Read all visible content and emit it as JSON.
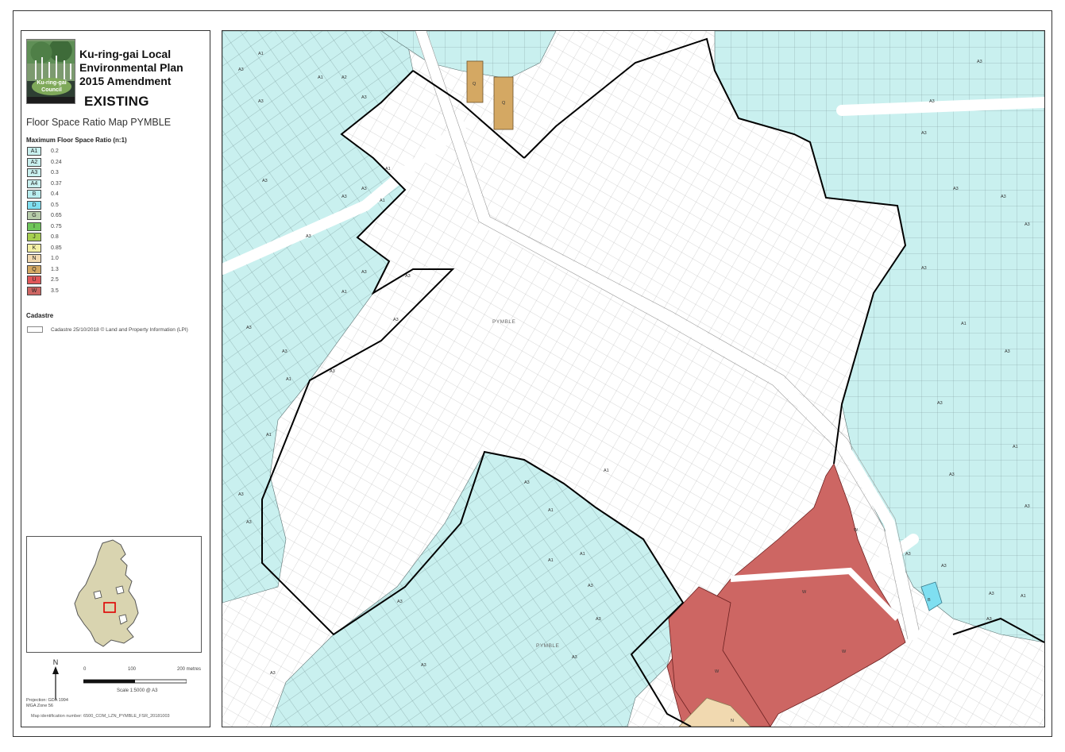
{
  "header": {
    "title_lines": [
      "Ku-ring-gai Local",
      "Environmental Plan",
      "2015 Amendment"
    ],
    "status": "EXISTING",
    "map_name": "Floor Space Ratio Map PYMBLE",
    "logo_text": "Ku-ring-gai Council"
  },
  "legend": {
    "heading": "Maximum Floor Space Ratio (n:1)",
    "items": [
      {
        "code": "A1",
        "value": "0.2",
        "color": "#c9f0ef"
      },
      {
        "code": "A2",
        "value": "0.24",
        "color": "#c9f0ef"
      },
      {
        "code": "A3",
        "value": "0.3",
        "color": "#c9f0ef"
      },
      {
        "code": "A4",
        "value": "0.37",
        "color": "#c9f0ef"
      },
      {
        "code": "B",
        "value": "0.4",
        "color": "#b9eef0"
      },
      {
        "code": "D",
        "value": "0.5",
        "color": "#7fdff1"
      },
      {
        "code": "G",
        "value": "0.65",
        "color": "#b7ccaa"
      },
      {
        "code": "I",
        "value": "0.75",
        "color": "#6fc65b"
      },
      {
        "code": "J",
        "value": "0.8",
        "color": "#a6cf4f"
      },
      {
        "code": "K",
        "value": "0.85",
        "color": "#f3f0a4"
      },
      {
        "code": "N",
        "value": "1.0",
        "color": "#f1d9b0"
      },
      {
        "code": "Q",
        "value": "1.3",
        "color": "#d4a863"
      },
      {
        "code": "U",
        "value": "2.5",
        "color": "#e0575a"
      },
      {
        "code": "W",
        "value": "3.5",
        "color": "#cd6663"
      }
    ]
  },
  "cadastre": {
    "heading": "Cadastre",
    "label": "Cadastre 25/10/2018 © Land and Property Information (LPI)"
  },
  "scale": {
    "north": "N",
    "ticks": [
      "0",
      "100",
      "200 metres"
    ],
    "text": "Scale  1:5000   @ A3",
    "projection": [
      "Projection: GDA 1994",
      "MGA Zone 56"
    ]
  },
  "map_id": "Map identification number:   6500_COM_LZN_PYMBLE_FSR_20181003",
  "map": {
    "place_labels": [
      "PYMBLE",
      "PYMBLE"
    ],
    "zone_labels": [
      "A1",
      "A3",
      "A3",
      "A1",
      "A2",
      "A3",
      "A1",
      "A3",
      "A3",
      "A1",
      "A3",
      "A3",
      "A3",
      "A3",
      "A1",
      "A3",
      "A3",
      "A3",
      "A1",
      "A3",
      "A1",
      "A3",
      "A3",
      "A3",
      "A1",
      "A1",
      "A3",
      "Q",
      "Q",
      "W",
      "W",
      "W",
      "W",
      "N",
      "A3",
      "A3",
      "A3",
      "A3",
      "A3",
      "A3",
      "A1",
      "A3",
      "A3",
      "A3",
      "A1",
      "A3",
      "A3",
      "A3",
      "A3",
      "B",
      "A3",
      "A1",
      "A3",
      "A1",
      "A1",
      "A3",
      "A3",
      "A3",
      "A3",
      "A3"
    ]
  }
}
